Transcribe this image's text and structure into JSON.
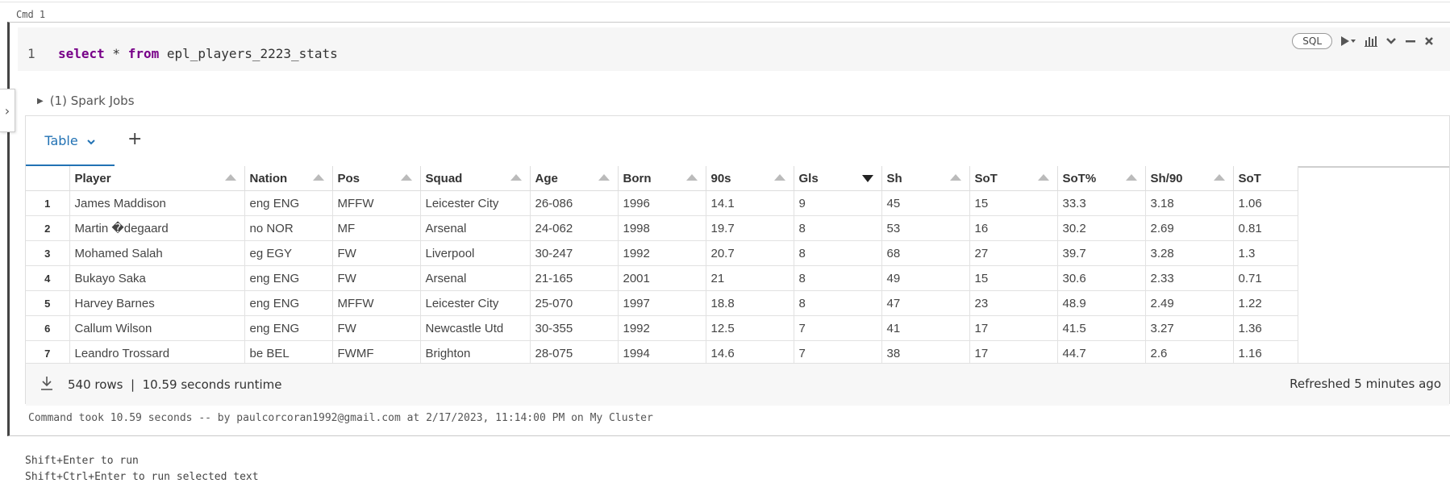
{
  "cell": {
    "label": "Cmd 1",
    "line_number": "1",
    "code_keyword_select": "select",
    "code_star": " * ",
    "code_keyword_from": "from",
    "code_table": " epl_players_2223_stats"
  },
  "toolbar": {
    "language": "SQL",
    "icons": [
      "run-icon",
      "chevron-down-icon",
      "chart-icon",
      "collapse-icon",
      "minimize-icon",
      "close-icon"
    ]
  },
  "spark_jobs": "(1) Spark Jobs",
  "tabs": {
    "table_label": "Table",
    "add": "+"
  },
  "table": {
    "columns": [
      "Player",
      "Nation",
      "Pos",
      "Squad",
      "Age",
      "Born",
      "90s",
      "Gls",
      "Sh",
      "SoT",
      "SoT%",
      "Sh/90",
      "SoT"
    ],
    "sorted_column": "Gls",
    "rows": [
      [
        "1",
        "James Maddison",
        "eng ENG",
        "MFFW",
        "Leicester City",
        "26-086",
        "1996",
        "14.1",
        "9",
        "45",
        "15",
        "33.3",
        "3.18",
        "1.06"
      ],
      [
        "2",
        "Martin �degaard",
        "no NOR",
        "MF",
        "Arsenal",
        "24-062",
        "1998",
        "19.7",
        "8",
        "53",
        "16",
        "30.2",
        "2.69",
        "0.81"
      ],
      [
        "3",
        "Mohamed Salah",
        "eg EGY",
        "FW",
        "Liverpool",
        "30-247",
        "1992",
        "20.7",
        "8",
        "68",
        "27",
        "39.7",
        "3.28",
        "1.3"
      ],
      [
        "4",
        "Bukayo Saka",
        "eng ENG",
        "FW",
        "Arsenal",
        "21-165",
        "2001",
        "21",
        "8",
        "49",
        "15",
        "30.6",
        "2.33",
        "0.71"
      ],
      [
        "5",
        "Harvey Barnes",
        "eng ENG",
        "MFFW",
        "Leicester City",
        "25-070",
        "1997",
        "18.8",
        "8",
        "47",
        "23",
        "48.9",
        "2.49",
        "1.22"
      ],
      [
        "6",
        "Callum Wilson",
        "eng ENG",
        "FW",
        "Newcastle Utd",
        "30-355",
        "1992",
        "12.5",
        "7",
        "41",
        "17",
        "41.5",
        "3.27",
        "1.36"
      ],
      [
        "7",
        "Leandro Trossard",
        "be BEL",
        "FWMF",
        "Brighton",
        "28-075",
        "1994",
        "14.6",
        "7",
        "38",
        "17",
        "44.7",
        "2.6",
        "1.16"
      ]
    ]
  },
  "footer": {
    "rows_info": "540 rows  |  10.59 seconds runtime",
    "refreshed": "Refreshed 5 minutes ago"
  },
  "command_took": "Command took 10.59 seconds -- by paulcorcoran1992@gmail.com at 2/17/2023, 11:14:00 PM on My Cluster",
  "hints": [
    "Shift+Enter to run",
    "Shift+Ctrl+Enter to run selected text"
  ]
}
